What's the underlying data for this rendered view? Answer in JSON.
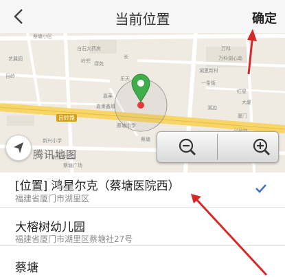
{
  "header": {
    "title": "当前位置",
    "confirm_label": "确定"
  },
  "map": {
    "logo": "腾讯地图",
    "labels": [
      "蔡塘小区",
      "白石大药房",
      "万科",
      "岭兜",
      "绿苑",
      "长",
      "万科湖心岛",
      "艺展园",
      "吕岭",
      "嘉莱",
      "乐天",
      "湖里新村",
      "一条街",
      "嘉莱鑫城",
      "红星",
      "大厦",
      "湖边",
      "吕岭路",
      "蔡塘中学",
      "厦门",
      "吕岭路",
      "蔡塘",
      "新兴小学",
      "新加坡花园",
      "蔡塘广场"
    ],
    "road_label": "吕岭路",
    "accent_color": "#3fae4a",
    "marker_color": "#e03a3a"
  },
  "results": [
    {
      "title": "[位置] 鸿星尔克（蔡塘医院西）",
      "address": "福建省厦门市湖里区",
      "selected": true
    },
    {
      "title": "大榕树幼儿园",
      "address": "福建省厦门市湖里区蔡塘社27号",
      "selected": false
    },
    {
      "title": "蔡塘",
      "address": "",
      "selected": false
    }
  ]
}
